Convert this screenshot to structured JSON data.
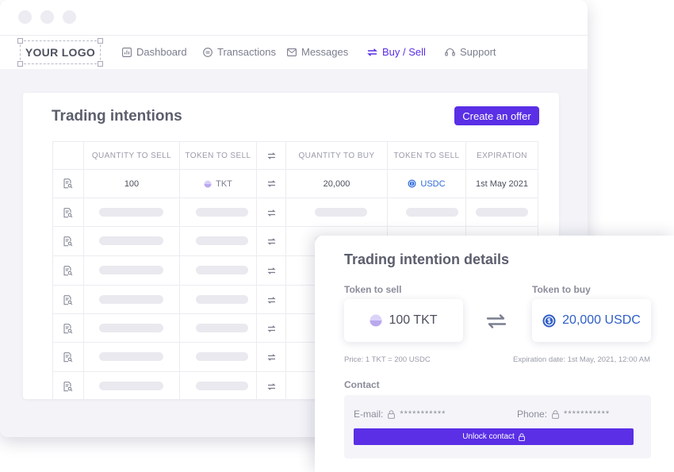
{
  "navbar": {
    "logo": "YOUR LOGO",
    "items": [
      {
        "label": "Dashboard",
        "icon": "chart-icon"
      },
      {
        "label": "Transactions",
        "icon": "coin-icon"
      },
      {
        "label": "Messages",
        "icon": "envelope-icon"
      },
      {
        "label": "Buy / Sell",
        "icon": "swap-icon",
        "active": true
      },
      {
        "label": "Support",
        "icon": "headset-icon"
      }
    ]
  },
  "trading": {
    "title": "Trading intentions",
    "create_button": "Create an offer",
    "columns": [
      "QUANTITY TO SELL",
      "TOKEN TO SELL",
      "QUANTITY TO BUY",
      "TOKEN TO SELL",
      "EXPIRATION"
    ],
    "row": {
      "quantity_to_sell": "100",
      "token_to_sell": "TKT",
      "quantity_to_buy": "20,000",
      "token_to_buy": "USDC",
      "expiration": "1st May 2021"
    }
  },
  "details": {
    "title": "Trading intention details",
    "sell_label": "Token to sell",
    "buy_label": "Token to buy",
    "sell_value": "100 TKT",
    "buy_value": "20,000 USDC",
    "price": "Price: 1 TKT = 200 USDC",
    "expiration": "Expiration date: 1st May, 2021, 12:00 AM",
    "contact_label": "Contact",
    "email_label": "E-mail:",
    "phone_label": "Phone:",
    "masked_email": "***********",
    "masked_phone": "***********",
    "unlock_button": "Unlock contact"
  },
  "colors": {
    "accent": "#5a2fe6",
    "link": "#2f6ad8",
    "tkt_token": "#b9a8ee"
  }
}
